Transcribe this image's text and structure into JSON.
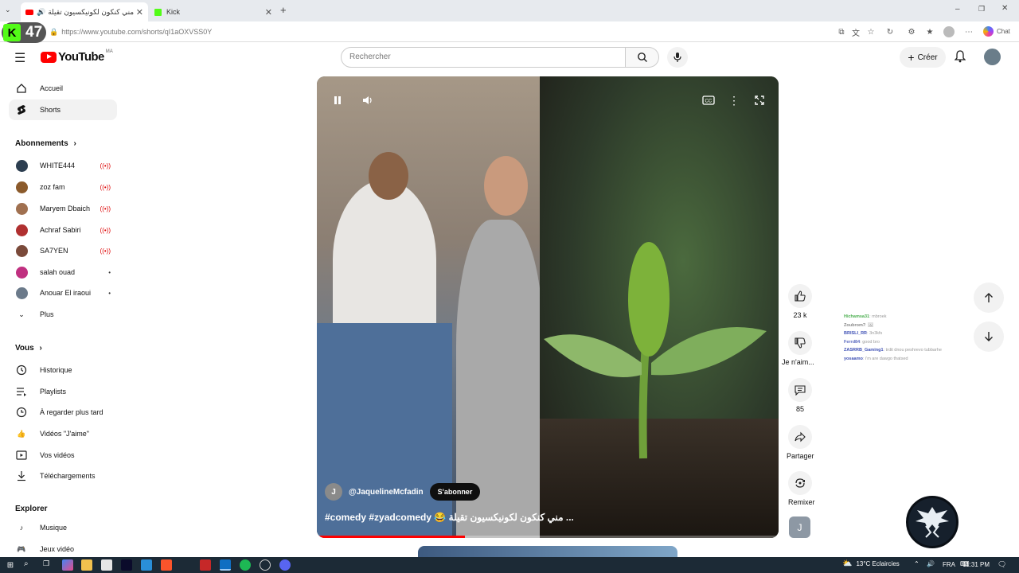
{
  "browser": {
    "tabs": [
      {
        "title": "مني كنكون لكونيكسيون تقيلة 😂",
        "active": true
      },
      {
        "title": "Kick",
        "active": false
      }
    ],
    "url": "https://www.youtube.com/shorts/qI1aOXVSS0Y",
    "kick_viewers": "47",
    "copilot_label": "Chat"
  },
  "header": {
    "logo_text": "YouTube",
    "country_code": "MA",
    "search_placeholder": "Rechercher",
    "create_label": "Créer"
  },
  "sidebar": {
    "main": [
      {
        "label": "Accueil",
        "icon": "home-icon"
      },
      {
        "label": "Shorts",
        "icon": "shorts-icon",
        "active": true
      }
    ],
    "subscriptions_title": "Abonnements",
    "subscriptions": [
      {
        "name": "WHITE444",
        "live": true,
        "color": "#2c3e50"
      },
      {
        "name": "zoz fam",
        "live": true,
        "color": "#8b5a2b"
      },
      {
        "name": "Maryem Dbaich",
        "live": true,
        "color": "#a07050"
      },
      {
        "name": "Achraf Sabiri",
        "live": true,
        "color": "#b03030"
      },
      {
        "name": "SA7YEN",
        "live": true,
        "color": "#7a4a3a"
      },
      {
        "name": "salah ouad",
        "live": false,
        "color": "#c03080"
      },
      {
        "name": "Anouar El iraoui",
        "live": false,
        "color": "#6b7a8a"
      }
    ],
    "more_label": "Plus",
    "you_title": "Vous",
    "you_items": [
      {
        "label": "Historique",
        "icon": "history-icon"
      },
      {
        "label": "Playlists",
        "icon": "playlists-icon"
      },
      {
        "label": "À regarder plus tard",
        "icon": "watch-later-icon"
      },
      {
        "label": "Vidéos \"J'aime\"",
        "icon": "liked-icon"
      },
      {
        "label": "Vos vidéos",
        "icon": "your-videos-icon"
      },
      {
        "label": "Téléchargements",
        "icon": "download-icon"
      }
    ],
    "explore_title": "Explorer",
    "explore_items": [
      {
        "label": "Musique",
        "icon": "music-icon"
      },
      {
        "label": "Jeux vidéo",
        "icon": "gaming-icon"
      }
    ]
  },
  "short": {
    "channel_handle": "@JaquelineMcfadin",
    "channel_initial": "J",
    "subscribe_label": "S'abonner",
    "caption": "#comedy #zyadcomedy 😂 مني كنكون لكونيكسيون تقيلة ...",
    "progress": 0.32
  },
  "actions": {
    "likes": "23 k",
    "dislike_label": "Je n'aim...",
    "comments": "85",
    "share_label": "Partager",
    "remix_label": "Remixer",
    "remix_avatar_initial": "J"
  },
  "chat": [
    {
      "user": "Hichamsa31",
      "msg": "mbroek",
      "color": "#4caf50"
    },
    {
      "user": "Zoubrom7",
      "msg": "🖼",
      "color": "#888"
    },
    {
      "user": "BRISLI_RR",
      "msg": "3n3kfs",
      "color": "#3f51b5"
    },
    {
      "user": "Ferrd84",
      "msg": "good bro",
      "color": "#5c6bc0"
    },
    {
      "user": "ZASRRB_Gaming1",
      "msg": "trdit dnou peshrevo tubbarhe",
      "color": "#3f51b5"
    },
    {
      "user": "yosaamo",
      "msg": "i'm are dawgo thatsed",
      "color": "#3f51b5"
    }
  ],
  "taskbar": {
    "weather": "13°C  Eclaircies",
    "lang": "FRA",
    "time": "11:31 PM"
  }
}
